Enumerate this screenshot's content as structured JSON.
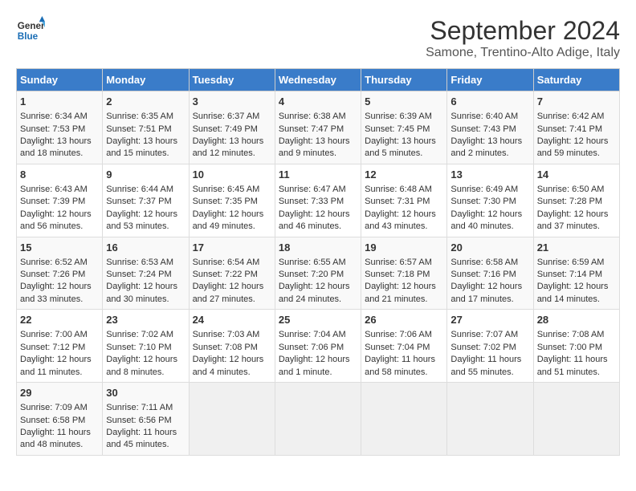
{
  "header": {
    "logo_line1": "General",
    "logo_line2": "Blue",
    "month_title": "September 2024",
    "subtitle": "Samone, Trentino-Alto Adige, Italy"
  },
  "columns": [
    "Sunday",
    "Monday",
    "Tuesday",
    "Wednesday",
    "Thursday",
    "Friday",
    "Saturday"
  ],
  "weeks": [
    [
      {
        "day": "1",
        "lines": [
          "Sunrise: 6:34 AM",
          "Sunset: 7:53 PM",
          "Daylight: 13 hours",
          "and 18 minutes."
        ]
      },
      {
        "day": "2",
        "lines": [
          "Sunrise: 6:35 AM",
          "Sunset: 7:51 PM",
          "Daylight: 13 hours",
          "and 15 minutes."
        ]
      },
      {
        "day": "3",
        "lines": [
          "Sunrise: 6:37 AM",
          "Sunset: 7:49 PM",
          "Daylight: 13 hours",
          "and 12 minutes."
        ]
      },
      {
        "day": "4",
        "lines": [
          "Sunrise: 6:38 AM",
          "Sunset: 7:47 PM",
          "Daylight: 13 hours",
          "and 9 minutes."
        ]
      },
      {
        "day": "5",
        "lines": [
          "Sunrise: 6:39 AM",
          "Sunset: 7:45 PM",
          "Daylight: 13 hours",
          "and 5 minutes."
        ]
      },
      {
        "day": "6",
        "lines": [
          "Sunrise: 6:40 AM",
          "Sunset: 7:43 PM",
          "Daylight: 13 hours",
          "and 2 minutes."
        ]
      },
      {
        "day": "7",
        "lines": [
          "Sunrise: 6:42 AM",
          "Sunset: 7:41 PM",
          "Daylight: 12 hours",
          "and 59 minutes."
        ]
      }
    ],
    [
      {
        "day": "8",
        "lines": [
          "Sunrise: 6:43 AM",
          "Sunset: 7:39 PM",
          "Daylight: 12 hours",
          "and 56 minutes."
        ]
      },
      {
        "day": "9",
        "lines": [
          "Sunrise: 6:44 AM",
          "Sunset: 7:37 PM",
          "Daylight: 12 hours",
          "and 53 minutes."
        ]
      },
      {
        "day": "10",
        "lines": [
          "Sunrise: 6:45 AM",
          "Sunset: 7:35 PM",
          "Daylight: 12 hours",
          "and 49 minutes."
        ]
      },
      {
        "day": "11",
        "lines": [
          "Sunrise: 6:47 AM",
          "Sunset: 7:33 PM",
          "Daylight: 12 hours",
          "and 46 minutes."
        ]
      },
      {
        "day": "12",
        "lines": [
          "Sunrise: 6:48 AM",
          "Sunset: 7:31 PM",
          "Daylight: 12 hours",
          "and 43 minutes."
        ]
      },
      {
        "day": "13",
        "lines": [
          "Sunrise: 6:49 AM",
          "Sunset: 7:30 PM",
          "Daylight: 12 hours",
          "and 40 minutes."
        ]
      },
      {
        "day": "14",
        "lines": [
          "Sunrise: 6:50 AM",
          "Sunset: 7:28 PM",
          "Daylight: 12 hours",
          "and 37 minutes."
        ]
      }
    ],
    [
      {
        "day": "15",
        "lines": [
          "Sunrise: 6:52 AM",
          "Sunset: 7:26 PM",
          "Daylight: 12 hours",
          "and 33 minutes."
        ]
      },
      {
        "day": "16",
        "lines": [
          "Sunrise: 6:53 AM",
          "Sunset: 7:24 PM",
          "Daylight: 12 hours",
          "and 30 minutes."
        ]
      },
      {
        "day": "17",
        "lines": [
          "Sunrise: 6:54 AM",
          "Sunset: 7:22 PM",
          "Daylight: 12 hours",
          "and 27 minutes."
        ]
      },
      {
        "day": "18",
        "lines": [
          "Sunrise: 6:55 AM",
          "Sunset: 7:20 PM",
          "Daylight: 12 hours",
          "and 24 minutes."
        ]
      },
      {
        "day": "19",
        "lines": [
          "Sunrise: 6:57 AM",
          "Sunset: 7:18 PM",
          "Daylight: 12 hours",
          "and 21 minutes."
        ]
      },
      {
        "day": "20",
        "lines": [
          "Sunrise: 6:58 AM",
          "Sunset: 7:16 PM",
          "Daylight: 12 hours",
          "and 17 minutes."
        ]
      },
      {
        "day": "21",
        "lines": [
          "Sunrise: 6:59 AM",
          "Sunset: 7:14 PM",
          "Daylight: 12 hours",
          "and 14 minutes."
        ]
      }
    ],
    [
      {
        "day": "22",
        "lines": [
          "Sunrise: 7:00 AM",
          "Sunset: 7:12 PM",
          "Daylight: 12 hours",
          "and 11 minutes."
        ]
      },
      {
        "day": "23",
        "lines": [
          "Sunrise: 7:02 AM",
          "Sunset: 7:10 PM",
          "Daylight: 12 hours",
          "and 8 minutes."
        ]
      },
      {
        "day": "24",
        "lines": [
          "Sunrise: 7:03 AM",
          "Sunset: 7:08 PM",
          "Daylight: 12 hours",
          "and 4 minutes."
        ]
      },
      {
        "day": "25",
        "lines": [
          "Sunrise: 7:04 AM",
          "Sunset: 7:06 PM",
          "Daylight: 12 hours",
          "and 1 minute."
        ]
      },
      {
        "day": "26",
        "lines": [
          "Sunrise: 7:06 AM",
          "Sunset: 7:04 PM",
          "Daylight: 11 hours",
          "and 58 minutes."
        ]
      },
      {
        "day": "27",
        "lines": [
          "Sunrise: 7:07 AM",
          "Sunset: 7:02 PM",
          "Daylight: 11 hours",
          "and 55 minutes."
        ]
      },
      {
        "day": "28",
        "lines": [
          "Sunrise: 7:08 AM",
          "Sunset: 7:00 PM",
          "Daylight: 11 hours",
          "and 51 minutes."
        ]
      }
    ],
    [
      {
        "day": "29",
        "lines": [
          "Sunrise: 7:09 AM",
          "Sunset: 6:58 PM",
          "Daylight: 11 hours",
          "and 48 minutes."
        ]
      },
      {
        "day": "30",
        "lines": [
          "Sunrise: 7:11 AM",
          "Sunset: 6:56 PM",
          "Daylight: 11 hours",
          "and 45 minutes."
        ]
      },
      {
        "day": "",
        "lines": []
      },
      {
        "day": "",
        "lines": []
      },
      {
        "day": "",
        "lines": []
      },
      {
        "day": "",
        "lines": []
      },
      {
        "day": "",
        "lines": []
      }
    ]
  ]
}
